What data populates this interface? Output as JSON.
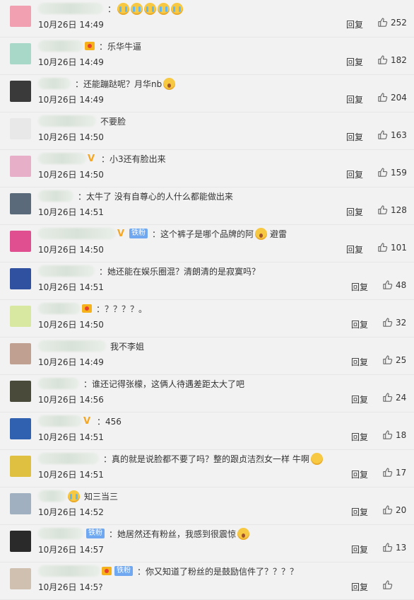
{
  "comments": [
    {
      "user_width": 92,
      "badge": "none",
      "text": "：",
      "emoji": [
        "cry",
        "cry",
        "cry",
        "cry",
        "cry"
      ],
      "time": "10月26日 14:49",
      "reply": "回复",
      "likes": "252",
      "avatar_color": "#f0a0b0"
    },
    {
      "user_width": 64,
      "badge": "crown",
      "text": "：乐华牛逼",
      "emoji": [],
      "time": "10月26日 14:49",
      "reply": "回复",
      "likes": "182",
      "avatar_color": "#a8d8c8"
    },
    {
      "user_width": 46,
      "badge": "none",
      "text": "：还能蹦跶呢？月华nb",
      "emoji": [
        "shock"
      ],
      "time": "10月26日 14:49",
      "reply": "回复",
      "likes": "204",
      "avatar_color": "#3a3a3a"
    },
    {
      "user_width": 82,
      "badge": "none",
      "text": "不要脸",
      "emoji": [],
      "time": "10月26日 14:50",
      "reply": "回复",
      "likes": "163",
      "avatar_color": "#e8e8e8"
    },
    {
      "user_width": 68,
      "badge": "v",
      "text": "：小3还有脸出来",
      "emoji": [],
      "time": "10月26日 14:50",
      "reply": "回复",
      "likes": "159",
      "avatar_color": "#e8b0c8"
    },
    {
      "user_width": 50,
      "badge": "none",
      "text": "：太牛了 没有自尊心的人什么都能做出来",
      "emoji": [],
      "time": "10月26日 14:51",
      "reply": "回复",
      "likes": "128",
      "avatar_color": "#5a6a7a"
    },
    {
      "user_width": 110,
      "badge": "vfan",
      "fan_label": "铁粉",
      "text": "：这个裤子是哪个品牌的阿",
      "emoji": [
        "shock"
      ],
      "extra_text": "避雷",
      "time": "10月26日 14:50",
      "reply": "回复",
      "likes": "101",
      "avatar_color": "#e05090"
    },
    {
      "user_width": 80,
      "badge": "none",
      "text": "：她还能在娱乐圈混？清朗清的是寂寞吗？",
      "emoji": [],
      "time": "10月26日 14:51",
      "reply": "回复",
      "likes": "48",
      "avatar_color": "#3050a0"
    },
    {
      "user_width": 60,
      "badge": "crown",
      "text": "：？？？？。",
      "emoji": [],
      "time": "10月26日 14:50",
      "reply": "回复",
      "likes": "32",
      "avatar_color": "#d8e8a0"
    },
    {
      "user_width": 96,
      "badge": "none",
      "text": "我不李姐",
      "emoji": [],
      "time": "10月26日 14:49",
      "reply": "回复",
      "likes": "25",
      "avatar_color": "#c0a090"
    },
    {
      "user_width": 58,
      "badge": "none",
      "text": "：谁还记得张檬，这俩人待遇差距太大了吧",
      "emoji": [],
      "time": "10月26日 14:56",
      "reply": "回复",
      "likes": "24",
      "avatar_color": "#4a4a3a"
    },
    {
      "user_width": 62,
      "badge": "v",
      "text": "：456",
      "emoji": [],
      "time": "10月26日 14:51",
      "reply": "回复",
      "likes": "18",
      "avatar_color": "#3060b0"
    },
    {
      "user_width": 86,
      "badge": "none",
      "text": "：真的就是说脸都不要了吗？整的跟贞洁烈女一样 牛啊",
      "emoji": [
        "smile"
      ],
      "time": "10月26日 14:51",
      "reply": "回复",
      "likes": "17",
      "avatar_color": "#e0c040"
    },
    {
      "user_width": 40,
      "badge": "none",
      "text": "知三当三",
      "emoji_before": [
        "cry"
      ],
      "emoji": [],
      "time": "10月26日 14:52",
      "reply": "回复",
      "likes": "20",
      "avatar_color": "#a0b0c0"
    },
    {
      "user_width": 64,
      "badge": "fan",
      "fan_label": "铁粉",
      "text": "：她居然还有粉丝，我感到很震惊",
      "emoji": [
        "shock"
      ],
      "time": "10月26日 14:57",
      "reply": "回复",
      "likes": "13",
      "avatar_color": "#2a2a2a"
    },
    {
      "user_width": 88,
      "badge": "crownfan",
      "fan_label": "铁粉",
      "text": "：你又知道了粉丝的是鼓励信件了？？？？",
      "emoji": [],
      "time": "10月26日 14:5?",
      "reply": "回复",
      "likes": "",
      "avatar_color": "#d0c0b0"
    }
  ]
}
